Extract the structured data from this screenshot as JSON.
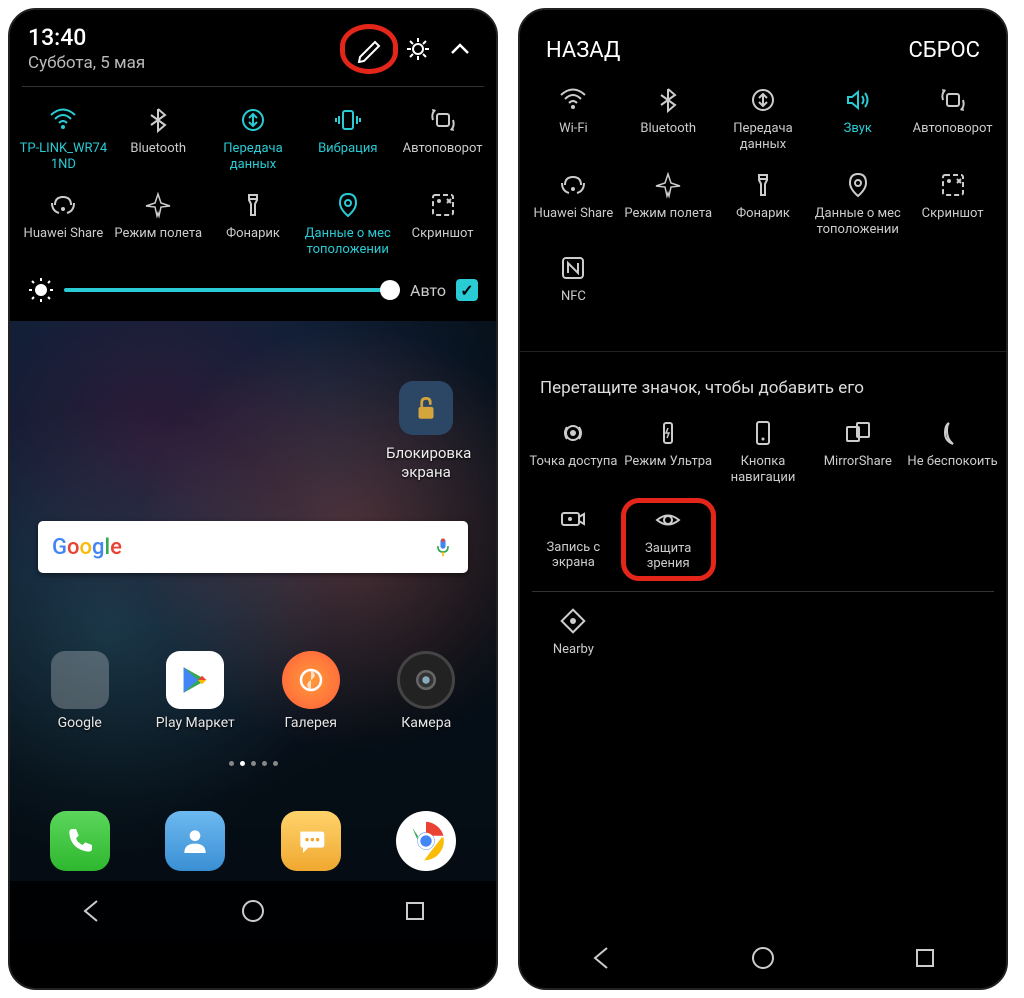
{
  "left": {
    "time": "13:40",
    "date": "Суббота, 5 мая",
    "auto_label": "Авто",
    "tiles": [
      {
        "label": "TP-LINK_WR74\n1ND",
        "active": true,
        "icon": "wifi"
      },
      {
        "label": "Bluetooth",
        "active": false,
        "icon": "bluetooth"
      },
      {
        "label": "Передача данных",
        "active": true,
        "icon": "data"
      },
      {
        "label": "Вибрация",
        "active": true,
        "icon": "vibrate"
      },
      {
        "label": "Автоповорот",
        "active": false,
        "icon": "rotate"
      },
      {
        "label": "Huawei Share",
        "active": false,
        "icon": "share"
      },
      {
        "label": "Режим полета",
        "active": false,
        "icon": "airplane"
      },
      {
        "label": "Фонарик",
        "active": false,
        "icon": "torch"
      },
      {
        "label": "Данные о мес\nтоположении",
        "active": true,
        "icon": "location"
      },
      {
        "label": "Скриншот",
        "active": false,
        "icon": "screenshot"
      }
    ],
    "lock_label": "Блокировка экрана",
    "apps": [
      {
        "label": "Google"
      },
      {
        "label": "Play Маркет"
      },
      {
        "label": "Галерея"
      },
      {
        "label": "Камера"
      }
    ]
  },
  "right": {
    "back": "НАЗАД",
    "reset": "СБРОС",
    "tiles": [
      {
        "label": "Wi-Fi",
        "icon": "wifi",
        "active": false
      },
      {
        "label": "Bluetooth",
        "icon": "bluetooth",
        "active": false
      },
      {
        "label": "Передача данных",
        "icon": "data",
        "active": false
      },
      {
        "label": "Звук",
        "icon": "sound",
        "active": true
      },
      {
        "label": "Автоповорот",
        "icon": "rotate",
        "active": false
      },
      {
        "label": "Huawei Share",
        "icon": "share",
        "active": false
      },
      {
        "label": "Режим полета",
        "icon": "airplane",
        "active": false
      },
      {
        "label": "Фонарик",
        "icon": "torch",
        "active": false
      },
      {
        "label": "Данные о мес\nтоположении",
        "icon": "location",
        "active": false
      },
      {
        "label": "Скриншот",
        "icon": "screenshot",
        "active": false
      }
    ],
    "nfc_label": "NFC",
    "section_title": "Перетащите значок, чтобы добавить его",
    "available": [
      {
        "label": "Точка доступа",
        "icon": "hotspot"
      },
      {
        "label": "Режим Ультра",
        "icon": "ultra"
      },
      {
        "label": "Кнопка навигации",
        "icon": "navbutton"
      },
      {
        "label": "MirrorShare",
        "icon": "mirror"
      },
      {
        "label": "Не беспокоить",
        "icon": "dnd"
      },
      {
        "label": "Запись с экрана",
        "icon": "record"
      },
      {
        "label": "Защита зрения",
        "icon": "eye",
        "highlight": true
      }
    ],
    "nearby_label": "Nearby"
  }
}
